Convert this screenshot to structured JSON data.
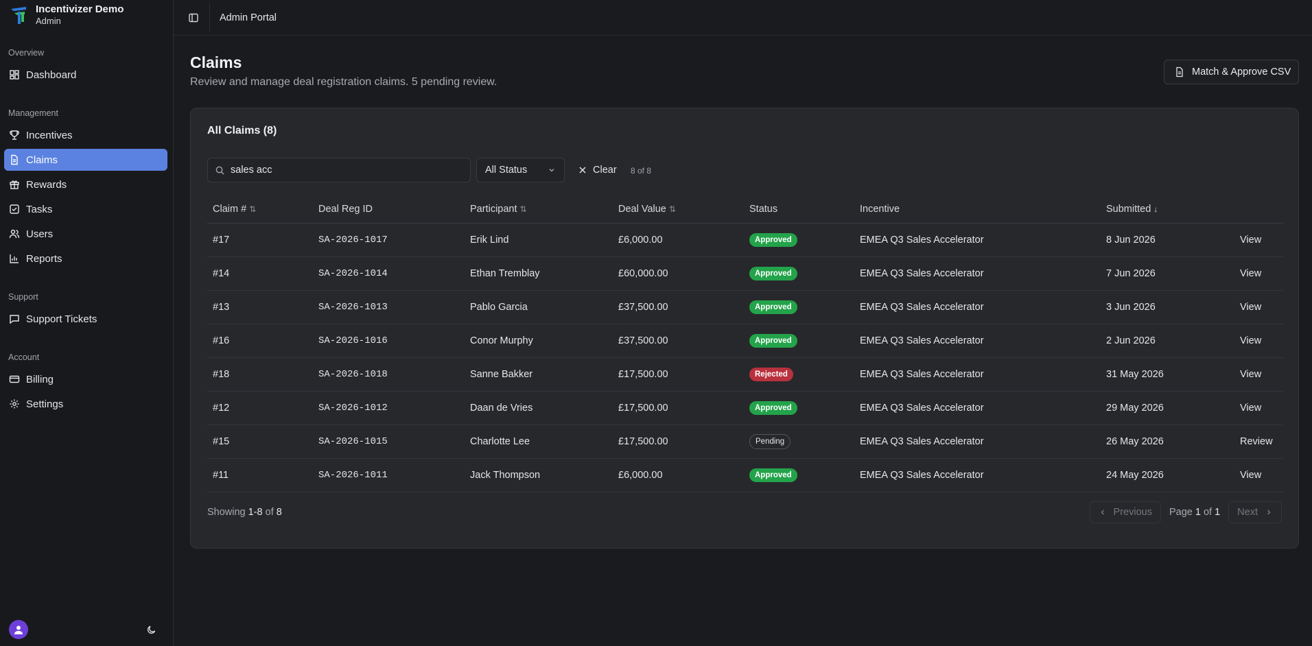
{
  "app": {
    "name": "Incentivizer Demo",
    "role": "Admin"
  },
  "sidebar": {
    "groups": [
      {
        "label": "Overview",
        "items": [
          {
            "label": "Dashboard",
            "icon": "dashboard-icon"
          }
        ]
      },
      {
        "label": "Management",
        "items": [
          {
            "label": "Incentives",
            "icon": "trophy-icon"
          },
          {
            "label": "Claims",
            "icon": "file-icon",
            "active": true
          },
          {
            "label": "Rewards",
            "icon": "gift-icon"
          },
          {
            "label": "Tasks",
            "icon": "checkbox-icon"
          },
          {
            "label": "Users",
            "icon": "users-icon"
          },
          {
            "label": "Reports",
            "icon": "bar-chart-icon"
          }
        ]
      },
      {
        "label": "Support",
        "items": [
          {
            "label": "Support Tickets",
            "icon": "message-icon"
          }
        ]
      },
      {
        "label": "Account",
        "items": [
          {
            "label": "Billing",
            "icon": "credit-card-icon"
          },
          {
            "label": "Settings",
            "icon": "gear-icon"
          }
        ]
      }
    ]
  },
  "topbar": {
    "title": "Admin Portal"
  },
  "page": {
    "title": "Claims",
    "subtitle": "Review and manage deal registration claims. 5 pending review.",
    "csv_button": "Match & Approve CSV"
  },
  "card": {
    "title": "All Claims (8)",
    "search_value": "sales acc",
    "status_filter": "All Status",
    "clear_label": "Clear",
    "count_label": "8 of 8"
  },
  "table": {
    "columns": [
      "Claim #",
      "Deal Reg ID",
      "Participant",
      "Deal Value",
      "Status",
      "Incentive",
      "Submitted",
      ""
    ],
    "rows": [
      {
        "claim": "#17",
        "deal_reg": "SA-2026-1017",
        "participant": "Erik Lind",
        "value": "£6,000.00",
        "status": "Approved",
        "incentive": "EMEA Q3 Sales Accelerator",
        "submitted": "8 Jun 2026",
        "action": "View"
      },
      {
        "claim": "#14",
        "deal_reg": "SA-2026-1014",
        "participant": "Ethan Tremblay",
        "value": "£60,000.00",
        "status": "Approved",
        "incentive": "EMEA Q3 Sales Accelerator",
        "submitted": "7 Jun 2026",
        "action": "View"
      },
      {
        "claim": "#13",
        "deal_reg": "SA-2026-1013",
        "participant": "Pablo Garcia",
        "value": "£37,500.00",
        "status": "Approved",
        "incentive": "EMEA Q3 Sales Accelerator",
        "submitted": "3 Jun 2026",
        "action": "View"
      },
      {
        "claim": "#16",
        "deal_reg": "SA-2026-1016",
        "participant": "Conor Murphy",
        "value": "£37,500.00",
        "status": "Approved",
        "incentive": "EMEA Q3 Sales Accelerator",
        "submitted": "2 Jun 2026",
        "action": "View"
      },
      {
        "claim": "#18",
        "deal_reg": "SA-2026-1018",
        "participant": "Sanne Bakker",
        "value": "£17,500.00",
        "status": "Rejected",
        "incentive": "EMEA Q3 Sales Accelerator",
        "submitted": "31 May 2026",
        "action": "View"
      },
      {
        "claim": "#12",
        "deal_reg": "SA-2026-1012",
        "participant": "Daan de Vries",
        "value": "£17,500.00",
        "status": "Approved",
        "incentive": "EMEA Q3 Sales Accelerator",
        "submitted": "29 May 2026",
        "action": "View"
      },
      {
        "claim": "#15",
        "deal_reg": "SA-2026-1015",
        "participant": "Charlotte Lee",
        "value": "£17,500.00",
        "status": "Pending",
        "incentive": "EMEA Q3 Sales Accelerator",
        "submitted": "26 May 2026",
        "action": "Review"
      },
      {
        "claim": "#11",
        "deal_reg": "SA-2026-1011",
        "participant": "Jack Thompson",
        "value": "£6,000.00",
        "status": "Approved",
        "incentive": "EMEA Q3 Sales Accelerator",
        "submitted": "24 May 2026",
        "action": "View"
      }
    ]
  },
  "footer": {
    "showing_prefix": "Showing",
    "showing_range": "1-8",
    "showing_of": "of",
    "showing_total": "8",
    "prev_label": "Previous",
    "next_label": "Next",
    "page_prefix": "Page",
    "page_current": "1",
    "page_of": "of",
    "page_total": "1"
  },
  "colors": {
    "accent": "#5b82e0",
    "approved": "#23a34a",
    "rejected": "#b8313d",
    "avatar": "#6d3fd8"
  }
}
